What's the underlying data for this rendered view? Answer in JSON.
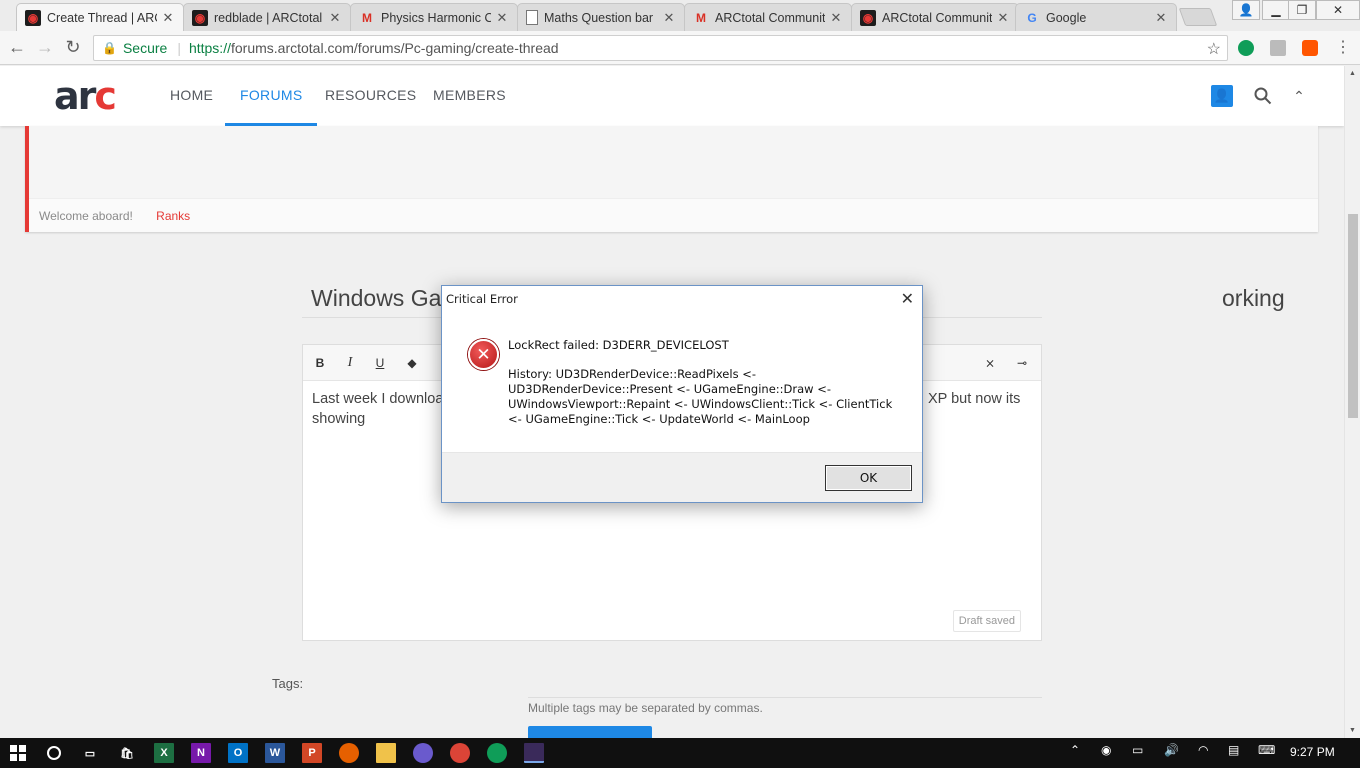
{
  "browser": {
    "tabs": [
      {
        "title": "Create Thread | ARC",
        "favicon": "arc-icon",
        "active": true
      },
      {
        "title": "redblade | ARCtotal",
        "favicon": "arc-icon",
        "active": false
      },
      {
        "title": "Physics Harmonic O",
        "favicon": "gmail-icon",
        "active": false
      },
      {
        "title": "Maths Question bar",
        "favicon": "document-icon",
        "active": false
      },
      {
        "title": "ARCtotal Communit",
        "favicon": "gmail-icon",
        "active": false
      },
      {
        "title": "ARCtotal Communit",
        "favicon": "arc-icon",
        "active": false
      },
      {
        "title": "Google",
        "favicon": "google-icon",
        "active": false
      }
    ],
    "secure_label": "Secure",
    "url_proto": "https://",
    "url_rest": "forums.arctotal.com/forums/Pc-gaming/create-thread"
  },
  "site": {
    "logo_main": "ar",
    "logo_accent": "c",
    "nav": [
      "HOME",
      "FORUMS",
      "RESOURCES",
      "MEMBERS"
    ],
    "active_nav": "FORUMS",
    "accent_color": "#1e88e5",
    "brand_red": "#e53935"
  },
  "notice": {
    "welcome": "Welcome aboard!",
    "ranks": "Ranks"
  },
  "thread": {
    "title_left": "Windows Ga",
    "title_right": "orking",
    "body_left": "Last week I downloa",
    "body_right": "XP but now its",
    "body_line2": "showing",
    "draft_status": "Draft saved"
  },
  "editor_toolbar": [
    "B",
    "I",
    "U"
  ],
  "tags": {
    "label": "Tags:",
    "hint": "Multiple tags may be separated by commas."
  },
  "dialog": {
    "title": "Critical Error",
    "message": "LockRect failed: D3DERR_DEVICELOST",
    "history": "History: UD3DRenderDevice::ReadPixels <- UD3DRenderDevice::Present <- UGameEngine::Draw <- UWindowsViewport::Repaint <- UWindowsClient::Tick <- ClientTick <- UGameEngine::Tick <- UpdateWorld <- MainLoop",
    "ok_label": "OK"
  },
  "taskbar": {
    "time": "9:27 PM"
  }
}
